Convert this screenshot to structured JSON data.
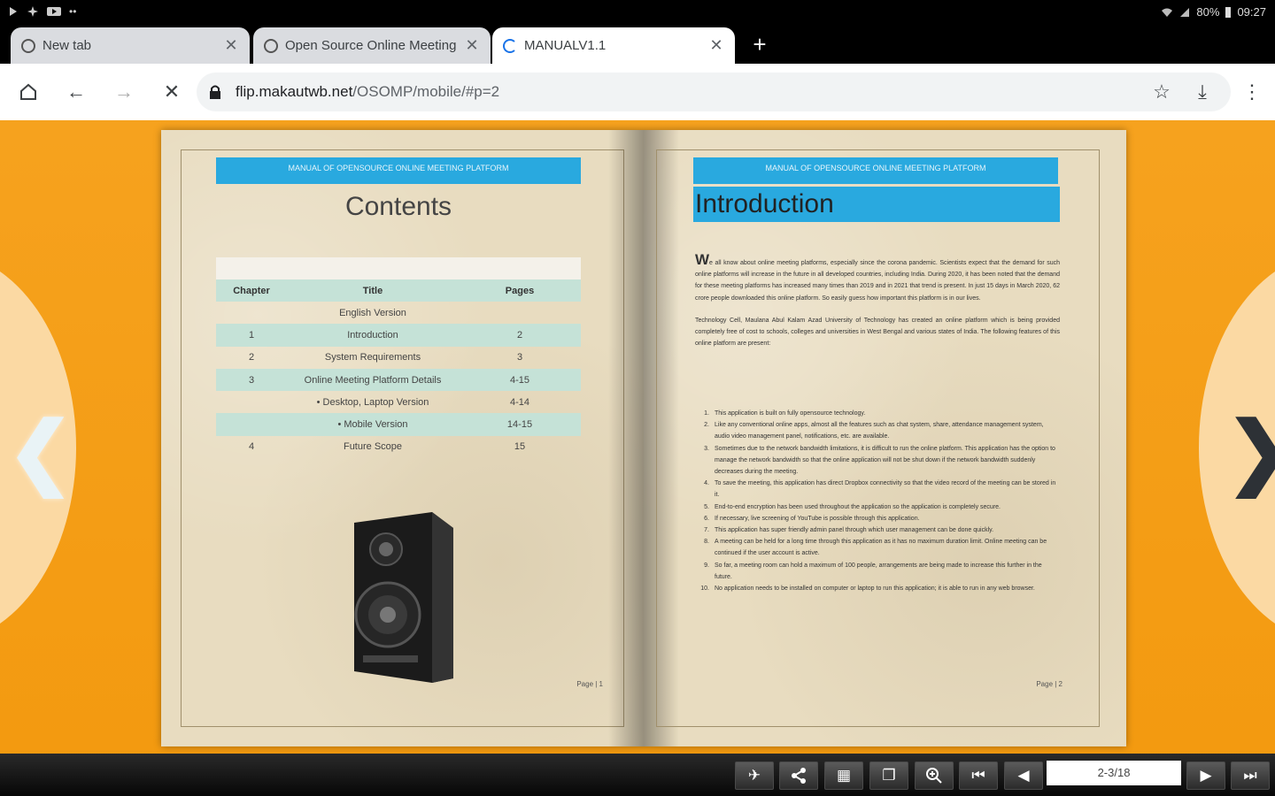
{
  "status_bar": {
    "left_icons": [
      "media-play-icon",
      "pinwheel-icon",
      "video-icon",
      "more-dots-icon"
    ],
    "battery": "80%",
    "time": "09:27"
  },
  "tabs": [
    {
      "label": "New tab",
      "active": false
    },
    {
      "label": "Open Source Online Meeting",
      "active": false
    },
    {
      "label": "MANUALV1.1",
      "active": true
    }
  ],
  "new_tab_label": "+",
  "toolbar": {
    "url_host": "flip.makautwb.net",
    "url_path": "/OSOMP/mobile/#p=2"
  },
  "book": {
    "left_page": {
      "header": "MANUAL OF OPENSOURCE ONLINE MEETING PLATFORM",
      "title": "Contents",
      "toc_headers": {
        "chapter": "Chapter",
        "title": "Title",
        "pages": "Pages"
      },
      "toc_rows": [
        {
          "chapter": "",
          "title": "English Version",
          "pages": ""
        },
        {
          "chapter": "1",
          "title": "Introduction",
          "pages": "2"
        },
        {
          "chapter": "2",
          "title": "System Requirements",
          "pages": "3"
        },
        {
          "chapter": "3",
          "title": "Online Meeting Platform Details",
          "pages": "4-15"
        },
        {
          "chapter": "",
          "title": "Desktop, Laptop Version",
          "pages": "4-14"
        },
        {
          "chapter": "",
          "title": "Mobile Version",
          "pages": "14-15"
        },
        {
          "chapter": "4",
          "title": "Future Scope",
          "pages": "15"
        }
      ],
      "page_number": "Page | 1"
    },
    "right_page": {
      "header": "MANUAL OF OPENSOURCE ONLINE MEETING PLATFORM",
      "title": "Introduction",
      "para1_dropcap": "W",
      "para1": "e all know about online meeting platforms, especially since the corona pandemic. Scientists expect that the demand for such online platforms will increase in the future in all developed countries, including India. During 2020, it has been noted that the demand for these meeting platforms has increased many times than 2019 and in 2021 that trend is present. In just 15 days in March 2020, 62 crore people downloaded this online platform. So easily guess how important this platform is in our lives.",
      "para2": "Technology Cell, Maulana Abul Kalam Azad University of Technology has created an online platform which is being provided completely free of cost to schools, colleges and universities in West Bengal and various states of India. The following features of this online platform are present:",
      "features": [
        "This application is built on fully opensource technology.",
        "Like any conventional online apps, almost all the features such as chat system, share, attendance management system, audio video management panel, notifications, etc. are available.",
        "Sometimes due to the network bandwidth limitations, it is difficult to run the online platform. This application has the option to manage the network bandwidth so that the online application will not be shut down if the network bandwidth suddenly decreases during the meeting.",
        "To save the meeting, this application has direct Dropbox connectivity so that the video record of the meeting can be stored in it.",
        "End-to-end encryption has been used throughout the application so the application is completely secure.",
        "If necessary, live screening of YouTube is possible through this application.",
        "This application has super friendly admin panel through which user management can be done quickly.",
        "A meeting can be held for a long time through this application as it has no maximum duration limit. Online meeting can be continued if the user account is active.",
        "So far, a meeting room can hold a maximum of 100 people, arrangements are being made to increase this further in the future.",
        "No application needs to be installed on computer or laptop to run this application; it is able to run in any web browser."
      ],
      "page_number": "Page | 2"
    }
  },
  "nav": {
    "prev": "❮",
    "next": "❯"
  },
  "bottom_bar": {
    "page_indicator": "2-3/18"
  },
  "colors": {
    "viewer_bg": "#f39a10",
    "header_blue": "#29a9df",
    "toc_shade": "#c5e2d7",
    "paper": "#e8dcc0"
  }
}
